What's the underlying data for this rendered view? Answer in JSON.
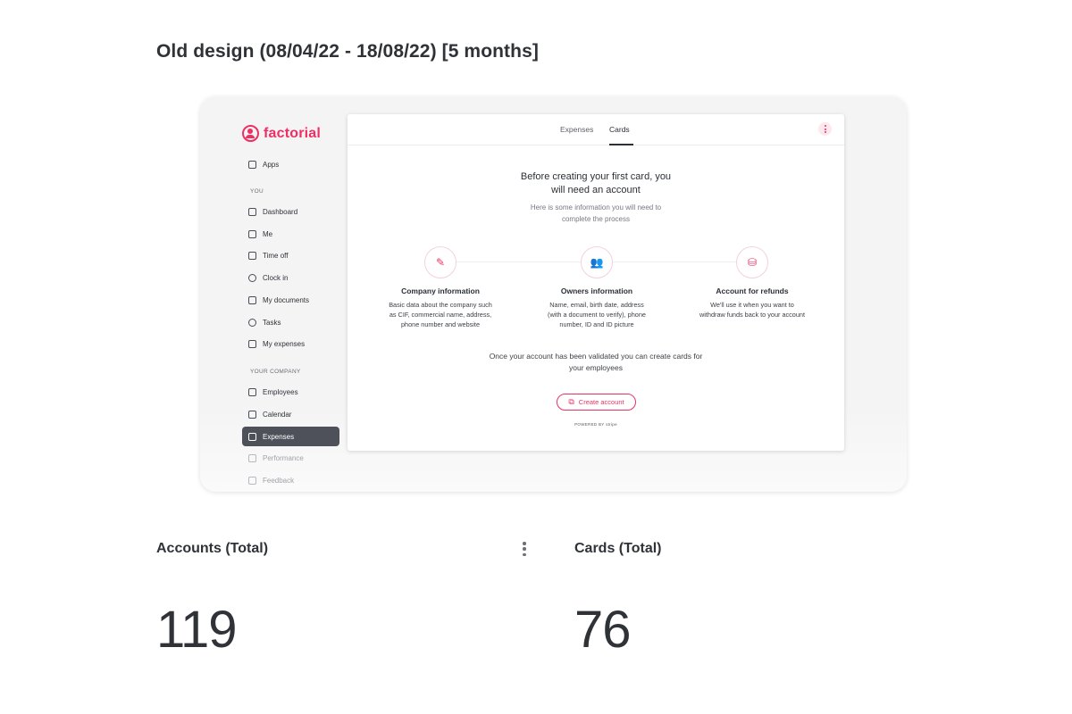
{
  "page": {
    "title": "Old design (08/04/22 - 18/08/22) [5 months]"
  },
  "screenshot": {
    "logo": {
      "text": "factorial",
      "color": "#ef2f63"
    },
    "sidebar": {
      "top_item": {
        "label": "Apps",
        "icon": "apps-icon"
      },
      "section_you": "YOU",
      "you_items": [
        {
          "label": "Dashboard",
          "icon": "home-icon"
        },
        {
          "label": "Me",
          "icon": "user-icon"
        },
        {
          "label": "Time off",
          "icon": "beach-icon"
        },
        {
          "label": "Clock in",
          "icon": "clock-icon"
        },
        {
          "label": "My documents",
          "icon": "folder-icon"
        },
        {
          "label": "Tasks",
          "icon": "check-circle-icon"
        },
        {
          "label": "My expenses",
          "icon": "receipt-icon"
        }
      ],
      "section_company": "YOUR COMPANY",
      "company_items": [
        {
          "label": "Employees",
          "icon": "people-icon"
        },
        {
          "label": "Calendar",
          "icon": "calendar-icon"
        },
        {
          "label": "Expenses",
          "icon": "receipt-icon",
          "active": true
        },
        {
          "label": "Performance",
          "icon": "presentation-icon"
        },
        {
          "label": "Feedback",
          "icon": "chat-icon"
        }
      ]
    },
    "tabs": [
      {
        "label": "Expenses",
        "active": false
      },
      {
        "label": "Cards",
        "active": true
      }
    ],
    "intro": {
      "title_line1": "Before creating your first card, you",
      "title_line2": "will need an account",
      "sub_line1": "Here is some information you will need to",
      "sub_line2": "complete the process"
    },
    "steps": [
      {
        "icon": "document-edit-icon",
        "glyph": "✎",
        "title": "Company information",
        "desc1": "Basic data about the company such",
        "desc2": "as CIF, commercial name, address,",
        "desc3": "phone number and website"
      },
      {
        "icon": "people-icon",
        "glyph": "👥",
        "title": "Owners information",
        "desc1": "Name, email, birth date, address",
        "desc2": "(with a document to verify), phone",
        "desc3": "number, ID and ID picture"
      },
      {
        "icon": "piggy-bank-icon",
        "glyph": "⛁",
        "title": "Account for refunds",
        "desc1": "We'll use it when you want to",
        "desc2": "withdraw funds back to your account",
        "desc3": ""
      }
    ],
    "validated_line1": "Once your account has been validated you can create cards for",
    "validated_line2": "your employees",
    "create_button": "Create account",
    "powered_by": "POWERED BY stripe"
  },
  "metrics": [
    {
      "label": "Accounts (Total)",
      "value": "119"
    },
    {
      "label": "Cards (Total)",
      "value": "76"
    }
  ],
  "colors": {
    "accent": "#ef2f63",
    "sidebar_active": "#4e505a",
    "text": "#2f3237"
  }
}
